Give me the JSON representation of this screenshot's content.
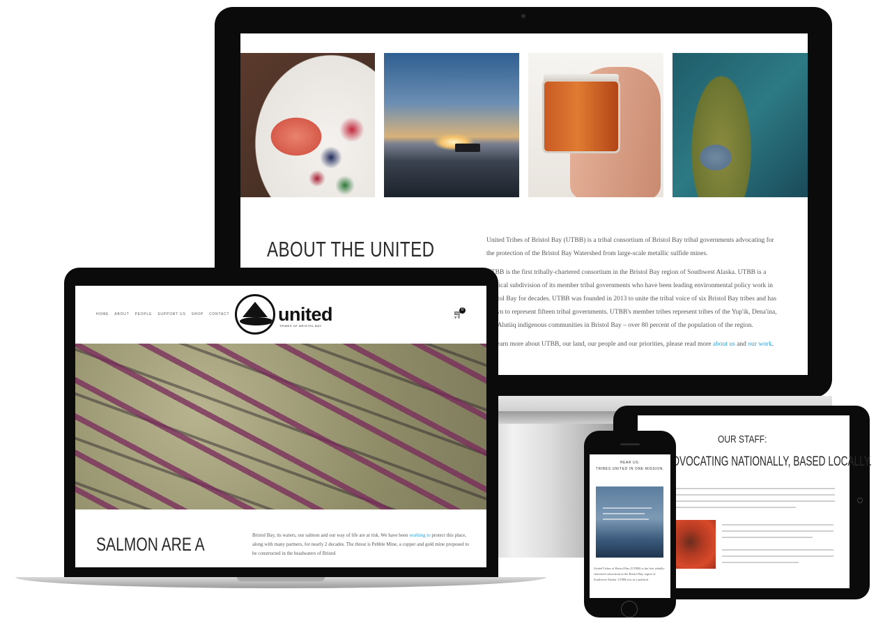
{
  "imac": {
    "about_title": "ABOUT THE UNITED",
    "about_p1": "United Tribes of Bristol Bay (UTBB) is a tribal consortium of Bristol Bay tribal governments advocating for the protection of the Bristol Bay Watershed from large-scale metallic sulfide mines.",
    "about_p2": "UTBB is the first tribally-chartered consortium in the Bristol Bay region of Southwest Alaska. UTBB is a political subdivision of its member tribal governments who have been leading environmental policy work in Bristol Bay for decades. UTBB was founded in 2013 to unite the tribal voice of six Bristol Bay tribes and has grown to represent fifteen tribal governments. UTBB's member tribes represent tribes of the Yup'ik, Dena'ina, and Alutiiq indigenous communities in Bristol Bay – over 80 percent of the population of the region.",
    "about_p3_before": "To learn more about UTBB, our land, our people and our priorities, please read more",
    "about_link1": "about us",
    "about_and": "and",
    "about_link2": "our work",
    "about_end": "."
  },
  "macbook": {
    "nav": [
      "HOME",
      "ABOUT",
      "PEOPLE",
      "SUPPORT US",
      "SHOP",
      "CONTACT"
    ],
    "logo_word": "united",
    "logo_sub": "TRIBES OF BRISTOL BAY",
    "cart_count": "0",
    "salmon_title": "SALMON ARE A",
    "salmon_text_1": "Bristol Bay, its waters, our salmon and our way of life are at risk. We have been",
    "salmon_link": "working to",
    "salmon_text_2": "protect this place, along with many partners, for nearly 2 decades. The threat is Pebble Mine, a copper and gold mine proposed to be constructed in the headwaters of Bristol"
  },
  "ipad": {
    "staff_title": "OUR STAFF:",
    "staff_sub": "ADVOCATING NATIONALLY, BASED LOCALLY."
  },
  "iphone": {
    "heading_1": "HEAR US:",
    "heading_2": "TRIBES UNITED IN ONE MISSION.",
    "text": "United Tribes of Bristol Bay (UTBB) is the first tribally-chartered consortium in the Bristol Bay region of Southwest Alaska. UTBB acts as a political"
  },
  "colors": {
    "link": "#2a9fd6",
    "bezel": "#0b0b0b"
  },
  "icons": {
    "cart": "cart-icon"
  }
}
